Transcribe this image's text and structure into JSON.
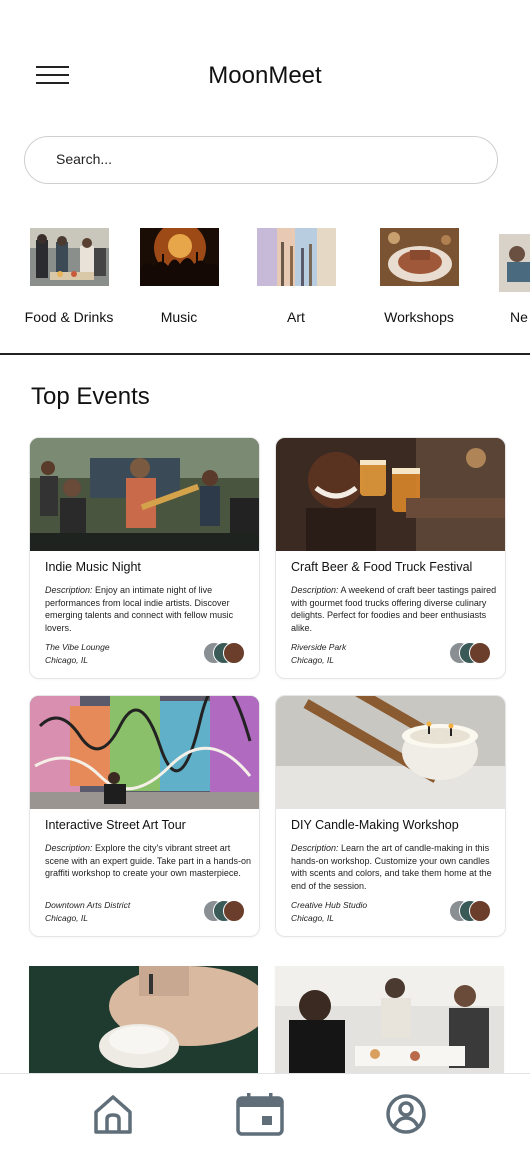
{
  "app": {
    "title": "MoonMeet"
  },
  "search": {
    "placeholder": "Search..."
  },
  "categories": [
    {
      "label": "Food & Drinks"
    },
    {
      "label": "Music"
    },
    {
      "label": "Art"
    },
    {
      "label": "Workshops"
    },
    {
      "label": "Ne"
    }
  ],
  "section": {
    "title": "Top Events"
  },
  "events": [
    {
      "title": "Indie Music Night",
      "description_label": "Description:",
      "description": " Enjoy an intimate night of live performances from local indie artists. Discover emerging talents and connect with fellow music lovers.",
      "venue": "The Vibe Lounge",
      "city": "Chicago, IL"
    },
    {
      "title": "Craft Beer & Food Truck Festival",
      "description_label": "Description:",
      "description": " A weekend of craft beer tastings paired with gourmet food trucks offering diverse culinary delights. Perfect for foodies and beer enthusiasts alike.",
      "venue": "Riverside Park",
      "city": "Chicago, IL"
    },
    {
      "title": "Interactive Street Art Tour",
      "description_label": "Description:",
      "description": " Explore the city's vibrant street art scene with an expert guide. Take part in a hands-on graffiti workshop to create your own masterpiece.",
      "venue": "Downtown Arts District",
      "city": "Chicago, IL"
    },
    {
      "title": "DIY Candle-Making Workshop",
      "description_label": "Description:",
      "description": " Learn the art of candle-making in this hands-on workshop. Customize your own candles with scents and colors, and take them home at the end of the session.",
      "venue": "Creative Hub Studio",
      "city": "Chicago, IL"
    }
  ],
  "tabbar": {
    "items": [
      {
        "icon": "home-icon"
      },
      {
        "icon": "calendar-icon"
      },
      {
        "icon": "profile-icon"
      }
    ]
  },
  "colors": {
    "icon": "#5f6e78",
    "text": "#111111",
    "border": "#e6e6e6"
  }
}
